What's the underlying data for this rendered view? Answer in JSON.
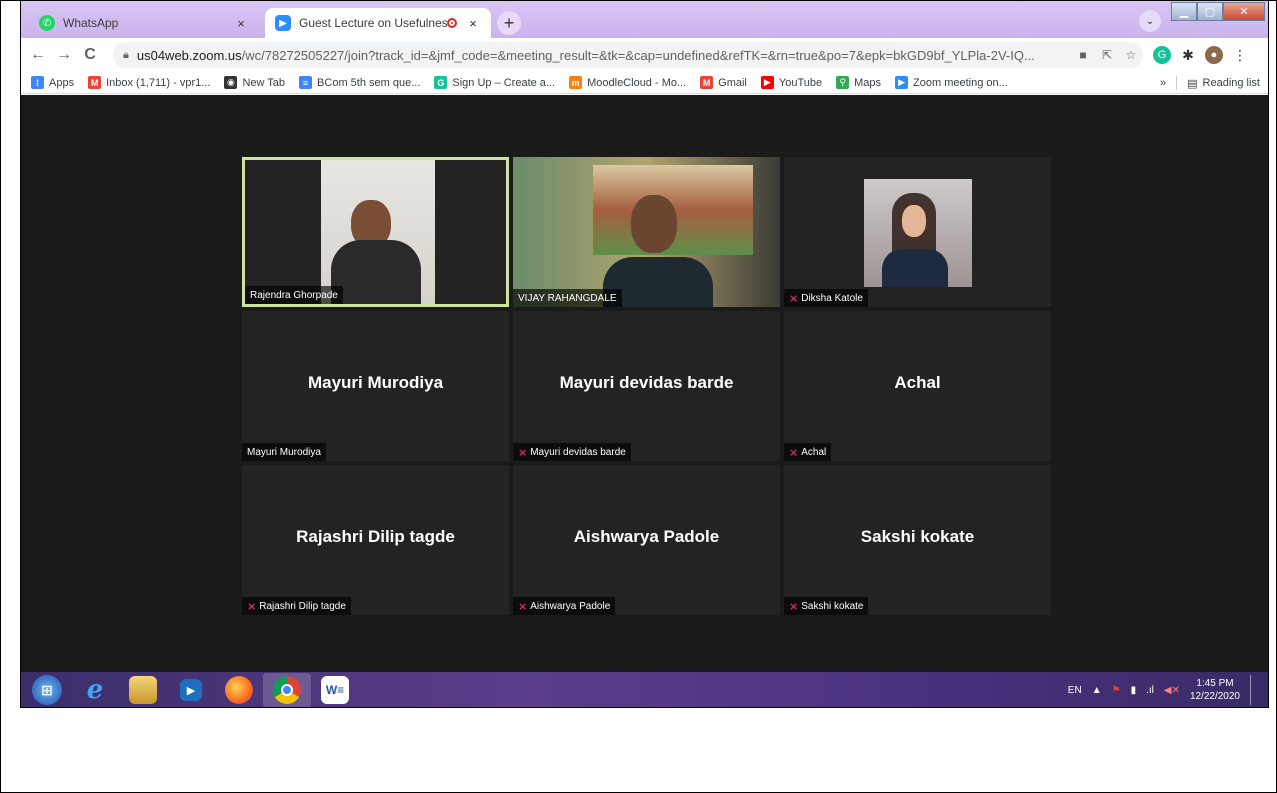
{
  "browser": {
    "tabs": [
      {
        "title": "WhatsApp",
        "close": "×"
      },
      {
        "title": "Guest Lecture on Usefulness",
        "close": "×"
      }
    ],
    "new_tab": "+",
    "url_host": "us04web.zoom.us",
    "url_path": "/wc/78272505227/join?track_id=&jmf_code=&meeting_result=&tk=&cap=undefined&refTK=&rn=true&po=7&epk=bkGD9bf_YLPla-2V-IQ...",
    "bookmarks": [
      {
        "label": "Apps",
        "icon": "apps-grid-icon",
        "color": "#4285f4"
      },
      {
        "label": "Inbox (1,711) - vpr1...",
        "icon": "gmail-icon",
        "color": "#ea4335"
      },
      {
        "label": "New Tab",
        "icon": "globe-icon",
        "color": "#333333"
      },
      {
        "label": "BCom 5th sem que...",
        "icon": "google-forms-icon",
        "color": "#4285f4"
      },
      {
        "label": "Sign Up – Create a...",
        "icon": "grammarly-icon",
        "color": "#15c39a"
      },
      {
        "label": "MoodleCloud - Mo...",
        "icon": "moodle-icon",
        "color": "#f98012"
      },
      {
        "label": "Gmail",
        "icon": "gmail-icon",
        "color": "#ea4335"
      },
      {
        "label": "YouTube",
        "icon": "youtube-icon",
        "color": "#ff0000"
      },
      {
        "label": "Maps",
        "icon": "maps-icon",
        "color": "#34a853"
      },
      {
        "label": "Zoom meeting on...",
        "icon": "zoom-icon",
        "color": "#2d8cff"
      }
    ],
    "overflow": "»",
    "reading_list": "Reading list"
  },
  "meeting": {
    "participants": [
      {
        "name": "Rajendra Ghorpade",
        "display": "",
        "muted": false,
        "video": true,
        "active": true
      },
      {
        "name": "VIJAY RAHANGDALE",
        "display": "",
        "muted": false,
        "video": true,
        "active": false
      },
      {
        "name": "Diksha Katole",
        "display": "",
        "muted": true,
        "video": true,
        "active": false
      },
      {
        "name": "Mayuri Murodiya",
        "display": "Mayuri Murodiya",
        "muted": false,
        "video": false,
        "active": false
      },
      {
        "name": "Mayuri devidas barde",
        "display": "Mayuri devidas barde",
        "muted": true,
        "video": false,
        "active": false
      },
      {
        "name": "Achal",
        "display": "Achal",
        "muted": true,
        "video": false,
        "active": false
      },
      {
        "name": "Rajashri Dilip tagde",
        "display": "Rajashri Dilip tagde",
        "muted": true,
        "video": false,
        "active": false
      },
      {
        "name": "Aishwarya Padole",
        "display": "Aishwarya Padole",
        "muted": true,
        "video": false,
        "active": false
      },
      {
        "name": "Sakshi kokate",
        "display": "Sakshi kokate",
        "muted": true,
        "video": false,
        "active": false
      }
    ]
  },
  "taskbar": {
    "lang": "EN",
    "time": "1:45 PM",
    "date": "12/22/2020",
    "apps": [
      "start-orb-icon",
      "internet-explorer-icon",
      "file-explorer-icon",
      "media-player-icon",
      "firefox-icon",
      "chrome-icon",
      "word-icon"
    ]
  },
  "colors": {
    "active_speaker_border": "#cde3a0",
    "muted_mic": "#e0245e",
    "zoom_bg": "#1a1a1a",
    "tile_bg": "#232323"
  }
}
